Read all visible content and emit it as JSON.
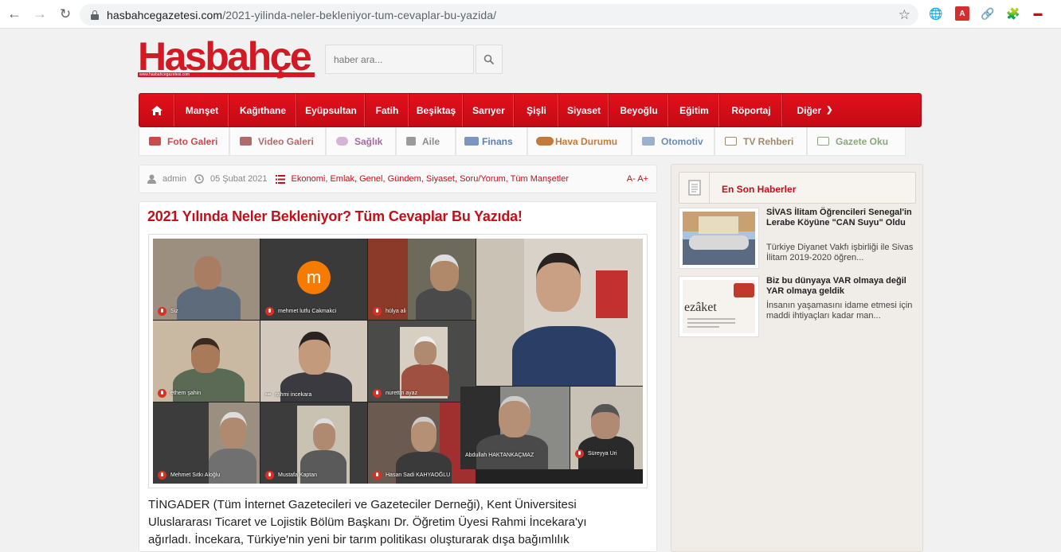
{
  "browser": {
    "url_domain": "hasbahcegazetesi.com",
    "url_path": "/2021-yilinda-neler-bekleniyor-tum-cevaplar-bu-yazida/"
  },
  "site": {
    "logo_text": "Hasbahçe",
    "logo_subtext": "www.hasbahcegazetesi.com",
    "search_placeholder": "haber ara...",
    "brand_color": "#d31924"
  },
  "main_nav": [
    "Manşet",
    "Kağıthane",
    "Eyüpsultan",
    "Fatih",
    "Beşiktaş",
    "Sarıyer",
    "Şişli",
    "Siyaset",
    "Beyoğlu",
    "Eğitim",
    "Röportaj",
    "Diğer"
  ],
  "sub_nav": [
    {
      "label": "Foto Galeri",
      "icon": "camera-icon",
      "color": "#c94a4a"
    },
    {
      "label": "Video Galeri",
      "icon": "video-icon",
      "color": "#b06a6a"
    },
    {
      "label": "Sağlık",
      "icon": "pill-icon",
      "color": "#a868a0"
    },
    {
      "label": "Aile",
      "icon": "home-icon",
      "color": "#8a8a8a"
    },
    {
      "label": "Finans",
      "icon": "money-icon",
      "color": "#5a7fb0"
    },
    {
      "label": "Hava Durumu",
      "icon": "weather-icon",
      "color": "#c27a3a"
    },
    {
      "label": "Otomotiv",
      "icon": "car-icon",
      "color": "#6a8ab5"
    },
    {
      "label": "TV Rehberi",
      "icon": "tv-icon",
      "color": "#a08a6a"
    },
    {
      "label": "Gazete Oku",
      "icon": "newspaper-icon",
      "color": "#8aa87a"
    }
  ],
  "meta": {
    "author": "admin",
    "date": "05 Şubat 2021",
    "categories": "Ekonomi, Emlak, Genel, Gündem, Siyaset, Soru/Yorum, Tüm Manşetler",
    "font_control": "A- A+"
  },
  "article": {
    "title": "2021 Yılında Neler Bekleniyor? Tüm Cevaplar Bu Yazıda!",
    "body_lines": [
      "TİNGADER (Tüm İnternet Gazetecileri ve Gazeteciler Derneği), Kent Üniversitesi",
      "Uluslararası Ticaret ve Lojistik Bölüm Başkanı Dr. Öğretim Üyesi Rahmi İncekara'yı",
      "ağırladı. İncekara, Türkiye'nin yeni bir tarım politikası oluşturarak dışa bağımlılık"
    ],
    "participants": [
      "Siz",
      "mehmet lutfu Cakmakci",
      "hülya ali",
      "ethem şahin",
      "rahmi incekara",
      "nurettin ayaz",
      "Mehmet Sıtkı Aloğlu",
      "Mustafa Kaptan",
      "Hasan Sadi KAHYAOĞLU",
      "Abdullah HAKTANKAÇMAZ",
      "Süreyya Uri"
    ],
    "avatar_letter": "m"
  },
  "sidebar": {
    "title": "En Son Haberler",
    "news": [
      {
        "title": "SİVAS İlitam Öğrencileri Senegal'in Lerabe Köyüne \"CAN Suyu\" Oldu",
        "summary": "Türkiye Diyanet Vakfı işbirliği ile Sivas İlitam 2019-2020 öğren..."
      },
      {
        "title": "Biz bu dünyaya VAR olmaya değil YAR olmaya geldik",
        "summary": "İnsanın yaşamasını idame etmesi için maddi ihtiyaçları kadar man...",
        "thumb_text": "ezâket"
      }
    ]
  }
}
